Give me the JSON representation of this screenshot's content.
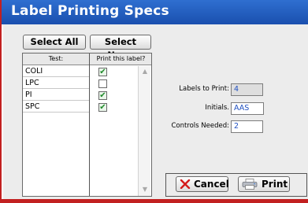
{
  "window": {
    "title": "Label Printing Specs"
  },
  "toolbar": {
    "select_all_label": "Select All",
    "select_none_label": "Select None"
  },
  "list": {
    "headers": {
      "test": "Test:",
      "print": "Print this label?"
    },
    "rows": [
      {
        "test": "COLI",
        "print": true
      },
      {
        "test": "LPC",
        "print": false
      },
      {
        "test": "PI",
        "print": true
      },
      {
        "test": "SPC",
        "print": true
      }
    ],
    "check_glyph": "✔"
  },
  "form": {
    "labels_to_print": {
      "label": "Labels to Print:",
      "value": "4"
    },
    "initials": {
      "label": "Initials.",
      "value": "AAS"
    },
    "controls_needed": {
      "label": "Controls Needed:",
      "value": "2"
    }
  },
  "actions": {
    "cancel_label": "Cancel",
    "print_label": "Print"
  },
  "icons": {
    "cancel": "close-icon",
    "print": "printer-icon",
    "scroll_up": "chevron-up-icon",
    "scroll_down": "chevron-down-icon"
  },
  "colors": {
    "title_bar": "#2f6fd0",
    "window_accent": "#c22020",
    "check": "#1f8a2a",
    "field_value": "#2050c0"
  }
}
